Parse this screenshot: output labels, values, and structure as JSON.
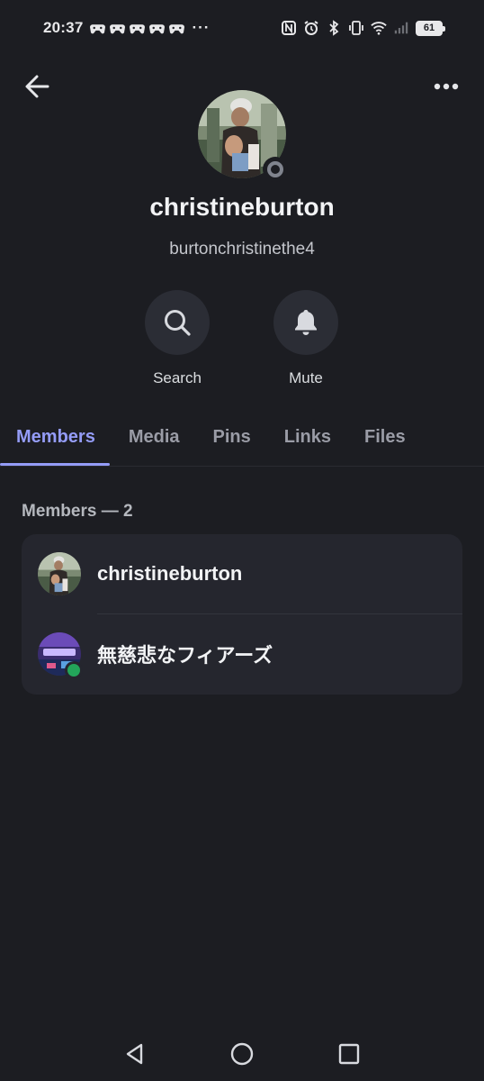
{
  "status_bar": {
    "time": "20:37",
    "more": "···",
    "battery": "61",
    "icons": [
      "game-controller-icon",
      "nfc-icon",
      "alarm-icon",
      "bluetooth-icon",
      "vibrate-icon",
      "wifi-icon",
      "signal-icon",
      "battery-icon"
    ]
  },
  "header": {
    "back_icon": "arrow-left-icon",
    "more_icon": "more-horizontal-icon"
  },
  "profile": {
    "display_name": "christineburton",
    "username": "burtonchristinethe4",
    "status": "offline"
  },
  "actions": [
    {
      "label": "Search",
      "icon": "search-icon"
    },
    {
      "label": "Mute",
      "icon": "bell-icon"
    }
  ],
  "tabs": [
    {
      "label": "Members",
      "active": true
    },
    {
      "label": "Media",
      "active": false
    },
    {
      "label": "Pins",
      "active": false
    },
    {
      "label": "Links",
      "active": false
    },
    {
      "label": "Files",
      "active": false
    }
  ],
  "members": {
    "title": "Members — 2",
    "items": [
      {
        "name": "christineburton",
        "online": false
      },
      {
        "name": "無慈悲なフィアーズ",
        "online": true
      }
    ]
  },
  "colors": {
    "background": "#1c1d22",
    "accent": "#949cf7",
    "card": "#25262e",
    "online": "#23a55a",
    "offline": "#80848e"
  }
}
